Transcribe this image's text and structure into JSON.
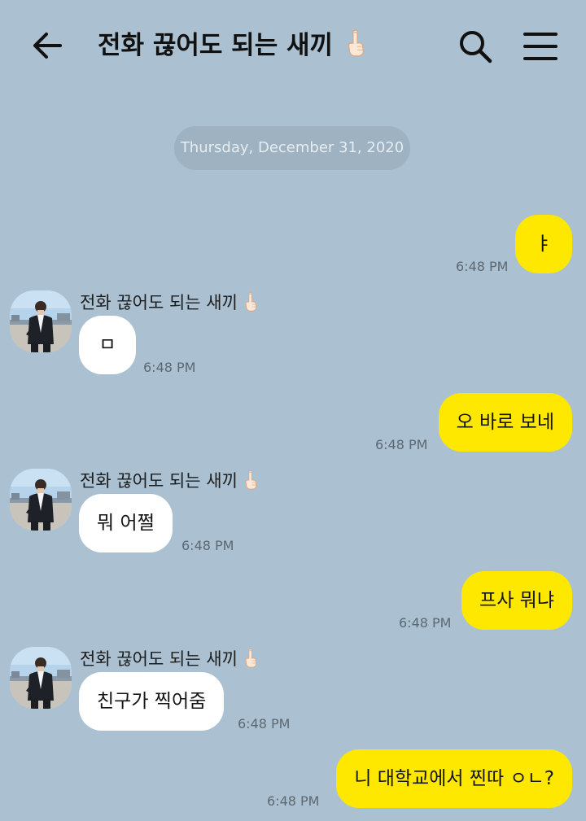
{
  "header": {
    "title": "전화 끊어도 되는 새끼",
    "back_icon": "arrow-left-icon",
    "search_icon": "search-icon",
    "menu_icon": "hamburger-menu-icon",
    "title_emoji": "middle-finger-emoji"
  },
  "date_divider": "Thursday, December 31, 2020",
  "colors": {
    "background": "#abc1d1",
    "outgoing": "#fee800",
    "incoming": "#ffffff"
  },
  "messages": [
    {
      "direction": "out",
      "text": "ㅑ",
      "time": "6:48 PM"
    },
    {
      "direction": "in",
      "sender": "전화 끊어도 되는 새끼",
      "text": "ㅁ",
      "time": "6:48 PM"
    },
    {
      "direction": "out",
      "text": "오 바로 보네",
      "time": "6:48 PM"
    },
    {
      "direction": "in",
      "sender": "전화 끊어도 되는 새끼",
      "text": "뭐 어쩔",
      "time": "6:48 PM"
    },
    {
      "direction": "out",
      "text": "프사 뭐냐",
      "time": "6:48 PM"
    },
    {
      "direction": "in",
      "sender": "전화 끊어도 되는 새끼",
      "text": "친구가 찍어줌",
      "time": "6:48 PM"
    },
    {
      "direction": "out",
      "text": "니 대학교에서 찐따 ㅇㄴ?",
      "time": "6:48 PM"
    }
  ]
}
